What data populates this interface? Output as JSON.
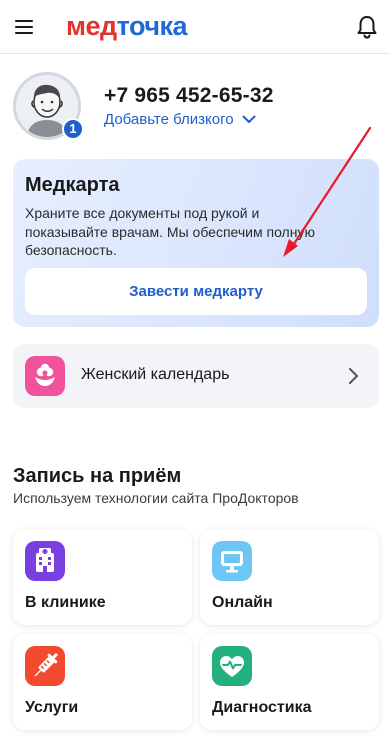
{
  "header": {
    "menu_icon": "hamburger-menu-icon",
    "logo_part1": "мед",
    "logo_part2": "точка",
    "notifications_icon": "bell-icon"
  },
  "profile": {
    "phone": "+7 965 452-65-32",
    "add_relative_label": "Добавьте близкого",
    "badge_count": "1",
    "avatar_icon": "user-avatar-icon"
  },
  "medcard": {
    "title": "Медкарта",
    "description": "Храните все документы под рукой и показывайте врачам. Мы обеспечим полную безопасность.",
    "button_label": "Завести медкарту"
  },
  "calendar": {
    "label": "Женский календарь",
    "icon": "flower-hand-icon",
    "chevron_icon": "chevron-right-icon"
  },
  "appointment": {
    "title": "Запись на приём",
    "subtitle": "Используем технологии сайта ПроДокторов",
    "tiles": [
      {
        "label": "В клинике",
        "icon": "clinic-building-icon",
        "color": "#7a3fe0"
      },
      {
        "label": "Онлайн",
        "icon": "monitor-icon",
        "color": "#6ec6f5"
      },
      {
        "label": "Услуги",
        "icon": "syringe-icon",
        "color": "#f24a2e"
      },
      {
        "label": "Диагностика",
        "icon": "heart-pulse-icon",
        "color": "#23b07d"
      }
    ]
  },
  "colors": {
    "brand_red": "#e4322c",
    "brand_blue": "#1f6ad6",
    "link_blue": "#1f5fcc",
    "arrow_red": "#e8192c"
  }
}
